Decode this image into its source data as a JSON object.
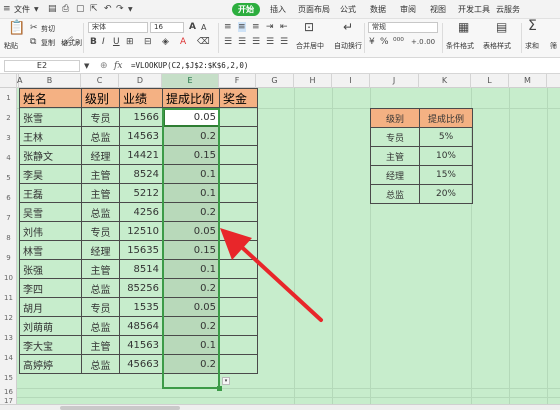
{
  "menu": {
    "file": "文件",
    "tabs": [
      "开始",
      "插入",
      "页面布局",
      "公式",
      "数据",
      "审阅",
      "视图",
      "开发工具",
      "云服务"
    ]
  },
  "ribbon": {
    "paste": "粘贴",
    "cut": "剪切",
    "copy": "复制",
    "format_painter": "格式刷",
    "font_name": "宋体",
    "font_size": "16",
    "merge_center": "合并居中",
    "wrap_text": "自动换行",
    "number_format": "常规",
    "conditional_format": "条件格式",
    "table_style": "表格样式",
    "sum": "求和",
    "filter": "筛"
  },
  "formula_bar": {
    "cell_ref": "E2",
    "fx": "fx",
    "formula": "=VLOOKUP(C2,$J$2:$K$6,2,0)"
  },
  "columns": [
    "A",
    "B",
    "C",
    "D",
    "E",
    "F",
    "G",
    "H",
    "I",
    "J",
    "K",
    "L",
    "M"
  ],
  "rows": [
    "1",
    "2",
    "3",
    "4",
    "5",
    "6",
    "7",
    "8",
    "9",
    "10",
    "11",
    "12",
    "13",
    "14",
    "15",
    "16",
    "17"
  ],
  "table": {
    "headers": [
      "姓名",
      "级别",
      "业绩",
      "提成比例",
      "奖金"
    ],
    "rows": [
      {
        "name": "张雪",
        "level": "专员",
        "perf": "1566",
        "rate": "0.05"
      },
      {
        "name": "王林",
        "level": "总监",
        "perf": "14563",
        "rate": "0.2"
      },
      {
        "name": "张静文",
        "level": "经理",
        "perf": "14421",
        "rate": "0.15"
      },
      {
        "name": "李昊",
        "level": "主管",
        "perf": "8524",
        "rate": "0.1"
      },
      {
        "name": "王磊",
        "level": "主管",
        "perf": "5212",
        "rate": "0.1"
      },
      {
        "name": "吴雪",
        "level": "总监",
        "perf": "4256",
        "rate": "0.2"
      },
      {
        "name": "刘伟",
        "level": "专员",
        "perf": "12510",
        "rate": "0.05"
      },
      {
        "name": "林雪",
        "level": "经理",
        "perf": "15635",
        "rate": "0.15"
      },
      {
        "name": "张强",
        "level": "主管",
        "perf": "8514",
        "rate": "0.1"
      },
      {
        "name": "李四",
        "level": "总监",
        "perf": "85256",
        "rate": "0.2"
      },
      {
        "name": "胡月",
        "level": "专员",
        "perf": "1535",
        "rate": "0.05"
      },
      {
        "name": "刘萌萌",
        "level": "总监",
        "perf": "48564",
        "rate": "0.2"
      },
      {
        "name": "李大宝",
        "level": "主管",
        "perf": "41563",
        "rate": "0.1"
      },
      {
        "name": "高婷婷",
        "level": "总监",
        "perf": "45663",
        "rate": "0.2"
      }
    ]
  },
  "ref_table": {
    "headers": [
      "级别",
      "提成比例"
    ],
    "rows": [
      {
        "level": "专员",
        "rate": "5%"
      },
      {
        "level": "主管",
        "rate": "10%"
      },
      {
        "level": "经理",
        "rate": "15%"
      },
      {
        "level": "总监",
        "rate": "20%"
      }
    ]
  },
  "colors": {
    "header_fill": "#f4b183",
    "sheet_bg": "#c7edcc",
    "selection_fill": "#b8d9ba",
    "active_tab": "#2cae3e",
    "arrow": "#e8262a"
  }
}
